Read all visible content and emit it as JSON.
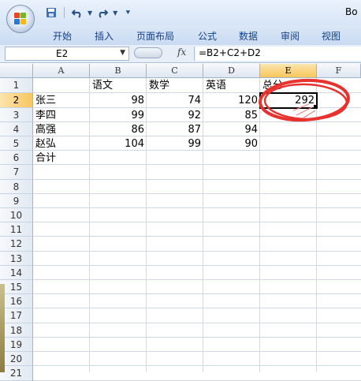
{
  "window": {
    "title": "Bo"
  },
  "quick_access": {
    "save_icon": "save-icon",
    "undo_icon": "undo-icon",
    "redo_icon": "redo-icon",
    "customize_icon": "customize-icon"
  },
  "ribbon": {
    "tabs": [
      "开始",
      "插入",
      "页面布局",
      "公式",
      "数据",
      "审阅",
      "视图"
    ]
  },
  "formula_bar": {
    "name_box": "E2",
    "fx": "fx",
    "formula": "=B2+C2+D2"
  },
  "sheet": {
    "columns": [
      "A",
      "B",
      "C",
      "D",
      "E",
      "F"
    ],
    "rows": [
      "1",
      "2",
      "3",
      "4",
      "5",
      "6",
      "7",
      "8",
      "9",
      "10",
      "11",
      "12",
      "13",
      "14",
      "15",
      "16",
      "17",
      "18",
      "19",
      "20",
      "21"
    ],
    "selected_cell": "E2",
    "header_row": {
      "B": "语文",
      "C": "数学",
      "D": "英语",
      "E": "总分"
    },
    "data": [
      {
        "name": "张三",
        "chinese": "98",
        "math": "74",
        "english": "120",
        "total": "292"
      },
      {
        "name": "李四",
        "chinese": "99",
        "math": "92",
        "english": "85",
        "total": ""
      },
      {
        "name": "高强",
        "chinese": "86",
        "math": "87",
        "english": "94",
        "total": ""
      },
      {
        "name": "赵弘",
        "chinese": "104",
        "math": "99",
        "english": "90",
        "total": ""
      }
    ],
    "footer_label": "合计"
  },
  "colors": {
    "annotation_red": "#e8322e",
    "selected_header": "#f7c65c",
    "ribbon_text": "#15428b"
  }
}
